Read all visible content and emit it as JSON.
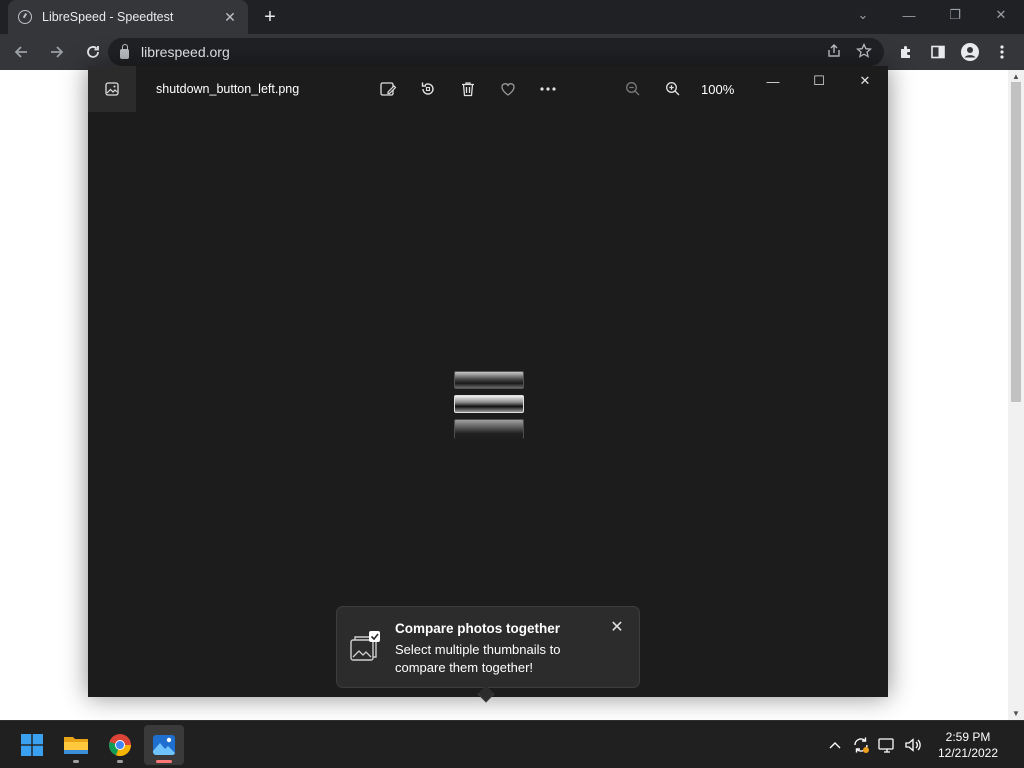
{
  "browser": {
    "tab_title": "LibreSpeed - Speedtest",
    "tab_close": "✕",
    "new_tab": "+",
    "url": "librespeed.org",
    "window_controls": {
      "minimize": "—",
      "restore": "❐",
      "close": "✕",
      "tab_list": "⌄"
    }
  },
  "photos": {
    "filename": "shutdown_button_left.png",
    "zoom": "100%",
    "window_controls": {
      "minimize": "—",
      "maximize": "☐",
      "close": "✕"
    }
  },
  "teaching_tip": {
    "title": "Compare photos together",
    "body": "Select multiple thumbnails to compare them together!",
    "close": "✕"
  },
  "taskbar": {
    "time": "2:59 PM",
    "date": "12/21/2022"
  },
  "colors": {
    "accent_photos": "#ff7878",
    "windows_blue": "#1e90ff"
  }
}
